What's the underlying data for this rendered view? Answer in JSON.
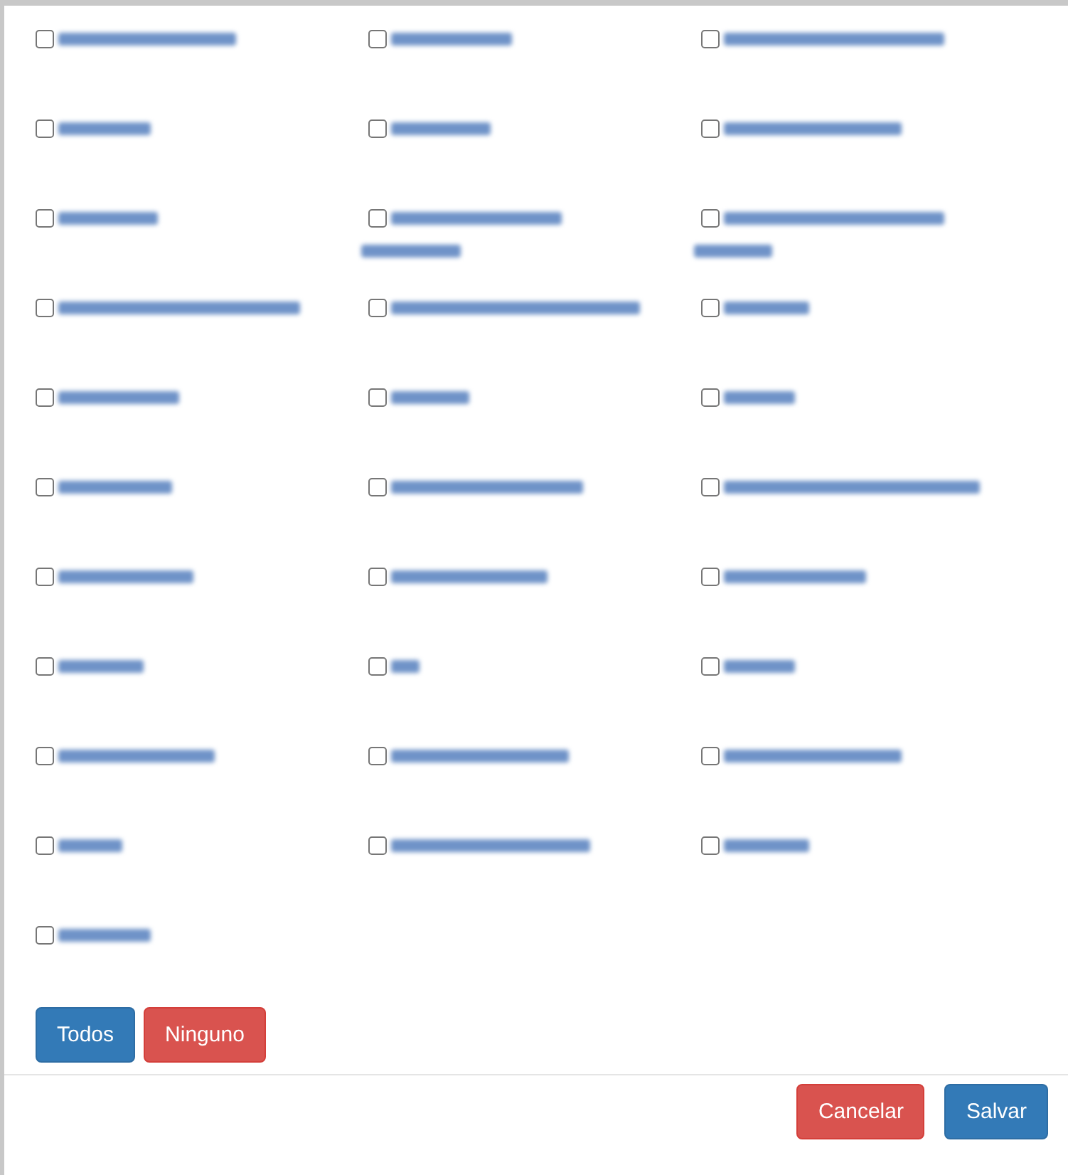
{
  "options": [
    {
      "checked": false
    },
    {
      "checked": false
    },
    {
      "checked": false
    },
    {
      "checked": false
    },
    {
      "checked": false
    },
    {
      "checked": false
    },
    {
      "checked": false
    },
    {
      "checked": false
    },
    {
      "checked": false
    },
    {
      "checked": false
    },
    {
      "checked": false
    },
    {
      "checked": false
    },
    {
      "checked": false
    },
    {
      "checked": false
    },
    {
      "checked": false
    },
    {
      "checked": false
    },
    {
      "checked": false
    },
    {
      "checked": false
    },
    {
      "checked": false
    },
    {
      "checked": false
    },
    {
      "checked": false
    },
    {
      "checked": false
    },
    {
      "checked": false
    },
    {
      "checked": false
    },
    {
      "checked": false
    },
    {
      "checked": false
    },
    {
      "checked": false
    },
    {
      "checked": false
    },
    {
      "checked": false
    },
    {
      "checked": false
    },
    {
      "checked": false
    }
  ],
  "select_buttons": [
    {
      "label": "Todos",
      "kind": "primary"
    },
    {
      "label": "Ninguno",
      "kind": "danger"
    }
  ],
  "footer_buttons": [
    {
      "label": "Cancelar",
      "kind": "danger"
    },
    {
      "label": "Salvar",
      "kind": "primary"
    }
  ]
}
